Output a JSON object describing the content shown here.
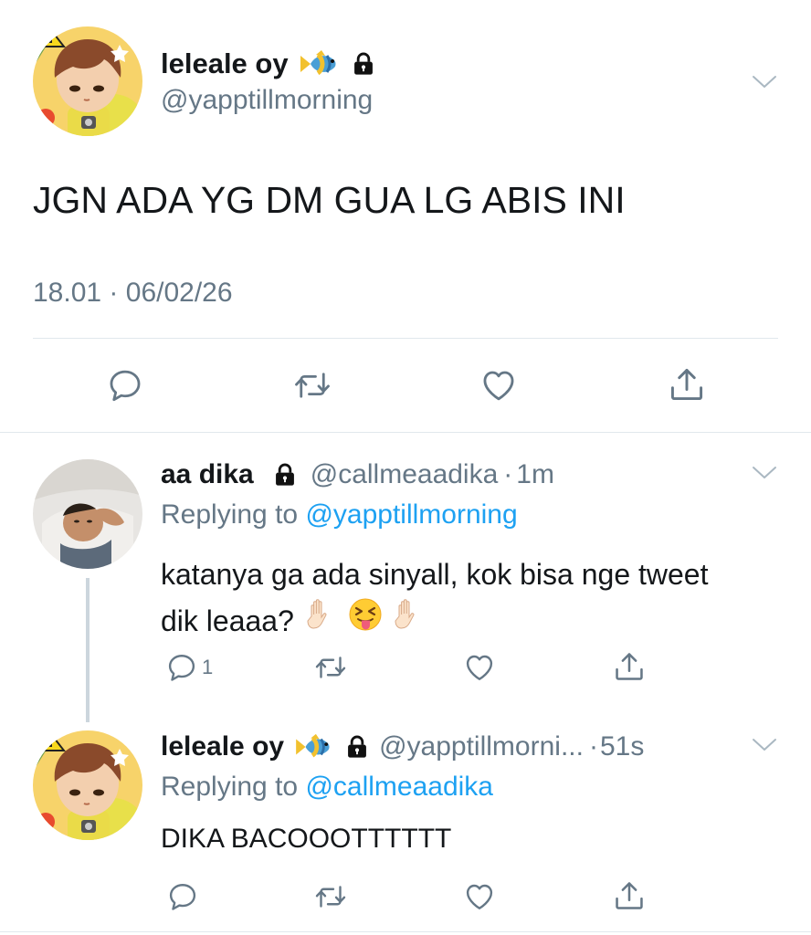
{
  "main_tweet": {
    "display_name": "leleale oy",
    "handle": "@yapptillmorning",
    "text": "JGN ADA YG DM GUA LG ABIS INI",
    "time": "18.01",
    "separator": "·",
    "date": "06/02/26"
  },
  "reply1": {
    "display_name": "aa dika",
    "handle": "@callmeaadika",
    "separator": "·",
    "time": "1m",
    "replying_prefix": "Replying to",
    "replying_to": "@yapptillmorning",
    "text_line1": "katanya ga ada sinyall, kok bisa nge tweet",
    "text_line2": "dik leaaa?",
    "reply_count": "1"
  },
  "reply2": {
    "display_name": "leleale oy",
    "handle": "@yapptillmorni...",
    "separator": "·",
    "time": "51s",
    "replying_prefix": "Replying to",
    "replying_to": "@callmeaadika",
    "text": "DIKA BACOOOTTTTTT"
  },
  "icons": [
    "fish-emoji-icon",
    "lock-icon",
    "chevron-down-icon",
    "reply-icon",
    "retweet-icon",
    "like-icon",
    "share-icon",
    "raised-hand-emoji-icon",
    "tongue-face-emoji-icon"
  ],
  "colors": {
    "link": "#1da1f2",
    "secondary_text": "#657786",
    "divider": "#e1e8ed"
  }
}
